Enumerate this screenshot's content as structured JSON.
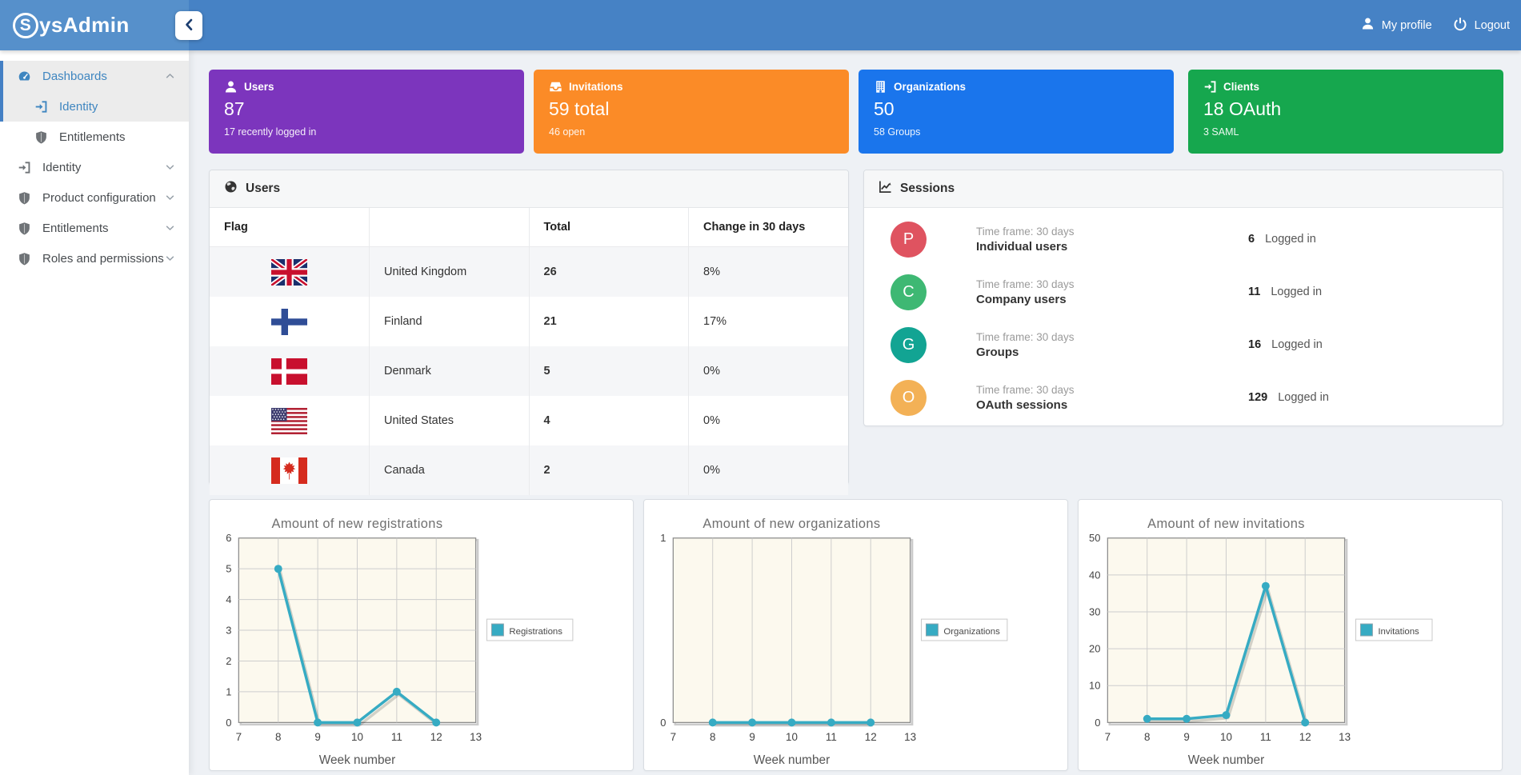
{
  "navbar": {
    "brand_circle_letter": "S",
    "brand_rest": "ysAdmin",
    "profile_label": "My profile",
    "logout_label": "Logout"
  },
  "sidebar": {
    "items": [
      {
        "label": "Dashboards",
        "icon": "tachometer",
        "expanded": true,
        "active": true,
        "children": [
          {
            "label": "Identity",
            "icon": "sign-in",
            "active": true
          },
          {
            "label": "Entitlements",
            "icon": "shield",
            "active": false
          }
        ]
      },
      {
        "label": "Identity",
        "icon": "sign-in",
        "expanded": false
      },
      {
        "label": "Product configuration",
        "icon": "shield",
        "expanded": false
      },
      {
        "label": "Entitlements",
        "icon": "shield",
        "expanded": false
      },
      {
        "label": "Roles and permissions",
        "icon": "shield",
        "expanded": false
      }
    ]
  },
  "stat_cards": [
    {
      "label": "Users",
      "value": "87",
      "sub": "17 recently logged in",
      "color": "#7c35bd",
      "icon": "user"
    },
    {
      "label": "Invitations",
      "value": "59 total",
      "sub": "46 open",
      "color": "#fb8b27",
      "icon": "inbox"
    },
    {
      "label": "Organizations",
      "value": "50",
      "sub": "58 Groups",
      "color": "#1a75ec",
      "icon": "building"
    },
    {
      "label": "Clients",
      "value": "18 OAuth",
      "sub": "3 SAML",
      "color": "#16a74e",
      "icon": "sign-in"
    }
  ],
  "users_panel": {
    "title": "Users",
    "columns": [
      "Flag",
      "",
      "Total",
      "Change in 30 days"
    ],
    "rows": [
      {
        "flag": "uk",
        "country": "United Kingdom",
        "total": "26",
        "change": "8%"
      },
      {
        "flag": "fi",
        "country": "Finland",
        "total": "21",
        "change": "17%"
      },
      {
        "flag": "dk",
        "country": "Denmark",
        "total": "5",
        "change": "0%"
      },
      {
        "flag": "us",
        "country": "United States",
        "total": "4",
        "change": "0%"
      },
      {
        "flag": "ca",
        "country": "Canada",
        "total": "2",
        "change": "0%"
      }
    ]
  },
  "sessions_panel": {
    "title": "Sessions",
    "rows": [
      {
        "letter": "P",
        "color": "#df5360",
        "timeframe": "Time frame: 30 days",
        "name": "Individual users",
        "count": "6",
        "status": "Logged in"
      },
      {
        "letter": "C",
        "color": "#3eb873",
        "timeframe": "Time frame: 30 days",
        "name": "Company users",
        "count": "11",
        "status": "Logged in"
      },
      {
        "letter": "G",
        "color": "#12a493",
        "timeframe": "Time frame: 30 days",
        "name": "Groups",
        "count": "16",
        "status": "Logged in"
      },
      {
        "letter": "O",
        "color": "#f3b156",
        "timeframe": "Time frame: 30 days",
        "name": "OAuth sessions",
        "count": "129",
        "status": "Logged in"
      }
    ]
  },
  "chart_data": [
    {
      "type": "line",
      "title": "Amount of new registrations",
      "xlabel": "Week number",
      "legend": "Registrations",
      "legend_position": "right",
      "color": "#36abc3",
      "grid": true,
      "x": [
        8,
        9,
        10,
        11,
        12
      ],
      "values": [
        5,
        0,
        0,
        1,
        0
      ],
      "xlim": [
        7,
        13
      ],
      "ylim": [
        0,
        6
      ],
      "xticks": [
        7,
        8,
        9,
        10,
        11,
        12,
        13
      ],
      "yticks": [
        0,
        1,
        2,
        3,
        4,
        5,
        6
      ]
    },
    {
      "type": "line",
      "title": "Amount of new organizations",
      "xlabel": "Week number",
      "legend": "Organizations",
      "legend_position": "right",
      "color": "#36abc3",
      "grid": true,
      "x": [
        8,
        9,
        10,
        11,
        12
      ],
      "values": [
        0,
        0,
        0,
        0,
        0
      ],
      "xlim": [
        7,
        13
      ],
      "ylim": [
        0,
        1
      ],
      "xticks": [
        7,
        8,
        9,
        10,
        11,
        12,
        13
      ],
      "yticks": [
        0,
        1
      ]
    },
    {
      "type": "line",
      "title": "Amount of new invitations",
      "xlabel": "Week number",
      "legend": "Invitations",
      "legend_position": "right",
      "color": "#36abc3",
      "grid": true,
      "x": [
        8,
        9,
        10,
        11,
        12
      ],
      "values": [
        1,
        1,
        2,
        37,
        0
      ],
      "xlim": [
        7,
        13
      ],
      "ylim": [
        0,
        50
      ],
      "xticks": [
        7,
        8,
        9,
        10,
        11,
        12,
        13
      ],
      "yticks": [
        0,
        10,
        20,
        30,
        40,
        50
      ]
    }
  ]
}
